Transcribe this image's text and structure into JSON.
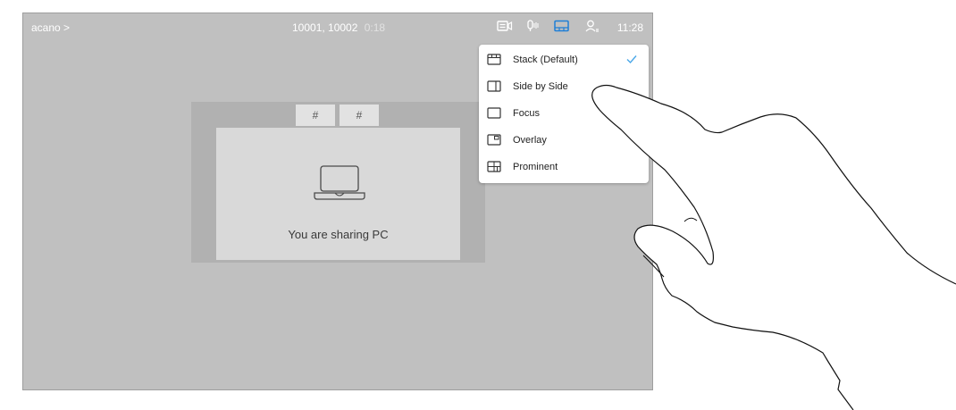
{
  "topbar": {
    "breadcrumb": "acano >",
    "call_numbers": "10001, 10002",
    "call_timer": "0:18",
    "clock": "11:28",
    "icons": [
      "video-icon",
      "microphone-icon",
      "layout-icon",
      "participants-icon"
    ]
  },
  "stage": {
    "tiles": [
      "#",
      "#"
    ],
    "sharing_text": "You are sharing PC"
  },
  "layout_menu": {
    "items": [
      {
        "label": "Stack (Default)",
        "icon": "stack-layout-icon",
        "selected": true
      },
      {
        "label": "Side by Side",
        "icon": "side-by-side-layout-icon",
        "selected": false
      },
      {
        "label": "Focus",
        "icon": "focus-layout-icon",
        "selected": false
      },
      {
        "label": "Overlay",
        "icon": "overlay-layout-icon",
        "selected": false
      },
      {
        "label": "Prominent",
        "icon": "prominent-layout-icon",
        "selected": false
      }
    ]
  },
  "colors": {
    "screen_bg": "#c0c0c0",
    "accent": "#1f7fd6",
    "check": "#4aa7e8"
  }
}
